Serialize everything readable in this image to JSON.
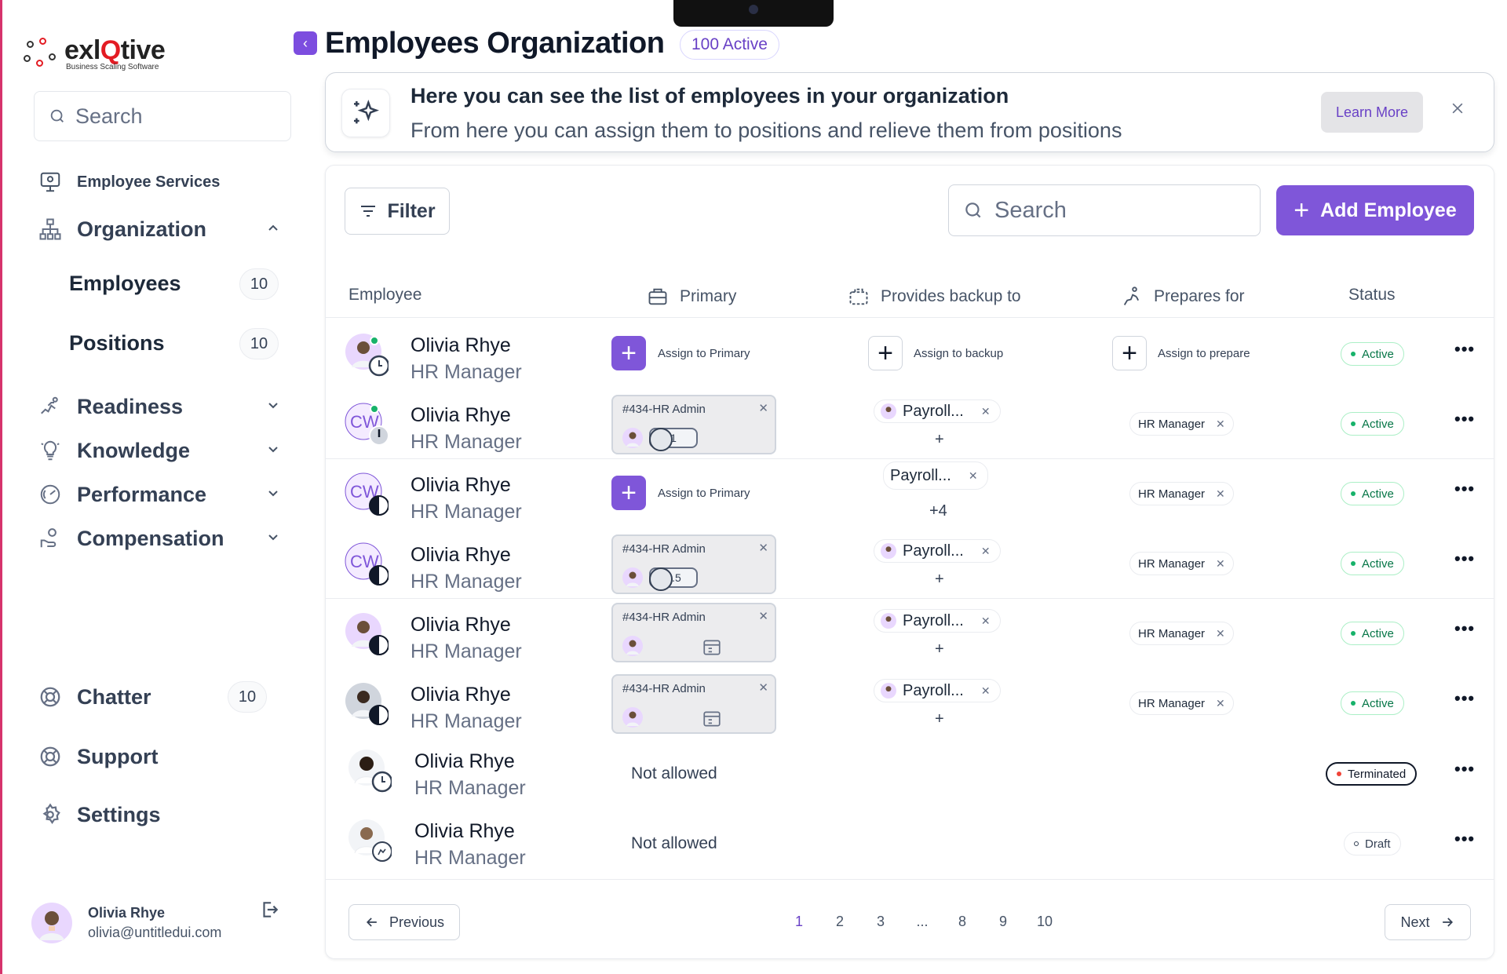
{
  "brand": {
    "name_pre": "exl",
    "name_accent": "Q",
    "name_post": "tive",
    "tagline": "Business Scaling Software",
    "accent": "#7f56d9"
  },
  "sidebar": {
    "search_placeholder": "Search",
    "employee_services": "Employee Services",
    "organization": "Organization",
    "employees": {
      "label": "Employees",
      "count": "10"
    },
    "positions": {
      "label": "Positions",
      "count": "10"
    },
    "readiness": "Readiness",
    "knowledge": "Knowledge",
    "performance": "Performance",
    "compensation": "Compensation",
    "chatter": {
      "label": "Chatter",
      "count": "10"
    },
    "support": "Support",
    "settings": "Settings",
    "user": {
      "name": "Olivia Rhye",
      "email": "olivia@untitledui.com"
    }
  },
  "header": {
    "title": "Employees Organization",
    "badge": "100 Active"
  },
  "banner": {
    "title": "Here you can see the list of employees in your organization",
    "desc": "From here you can assign them to positions and relieve them from positions",
    "learn_more": "Learn More"
  },
  "toolbar": {
    "filter": "Filter",
    "search_placeholder": "Search",
    "add": "Add Employee"
  },
  "columns": {
    "employee": "Employee",
    "primary": "Primary",
    "backup": "Provides backup to",
    "prepares": "Prepares for",
    "status": "Status"
  },
  "labels": {
    "assign_primary": "Assign to Primary",
    "assign_backup": "Assign to backup",
    "assign_prepare": "Assign to prepare",
    "not_allowed": "Not allowed",
    "position_code": "#434-HR Admin",
    "payroll": "Payroll...",
    "hr_manager": "HR Manager",
    "plus": "+",
    "plus4": "+4",
    "fte_1": "1",
    "fte_05": "0.5"
  },
  "rows": [
    {
      "name": "Olivia Rhye",
      "role": "HR Manager",
      "status": "Active"
    },
    {
      "name": "Olivia Rhye",
      "role": "HR Manager",
      "status": "Active",
      "initials": "CW"
    },
    {
      "name": "Olivia Rhye",
      "role": "HR Manager",
      "status": "Active",
      "initials": "CW"
    },
    {
      "name": "Olivia Rhye",
      "role": "HR Manager",
      "status": "Active",
      "initials": "CW"
    },
    {
      "name": "Olivia Rhye",
      "role": "HR Manager",
      "status": "Active"
    },
    {
      "name": "Olivia Rhye",
      "role": "HR Manager",
      "status": "Active"
    },
    {
      "name": "Olivia Rhye",
      "role": "HR Manager",
      "status": "Terminated"
    },
    {
      "name": "Olivia Rhye",
      "role": "HR Manager",
      "status": "Draft"
    }
  ],
  "pagination": {
    "previous": "Previous",
    "next": "Next",
    "pages": [
      "1",
      "2",
      "3",
      "...",
      "8",
      "9",
      "10"
    ],
    "current": "1"
  }
}
